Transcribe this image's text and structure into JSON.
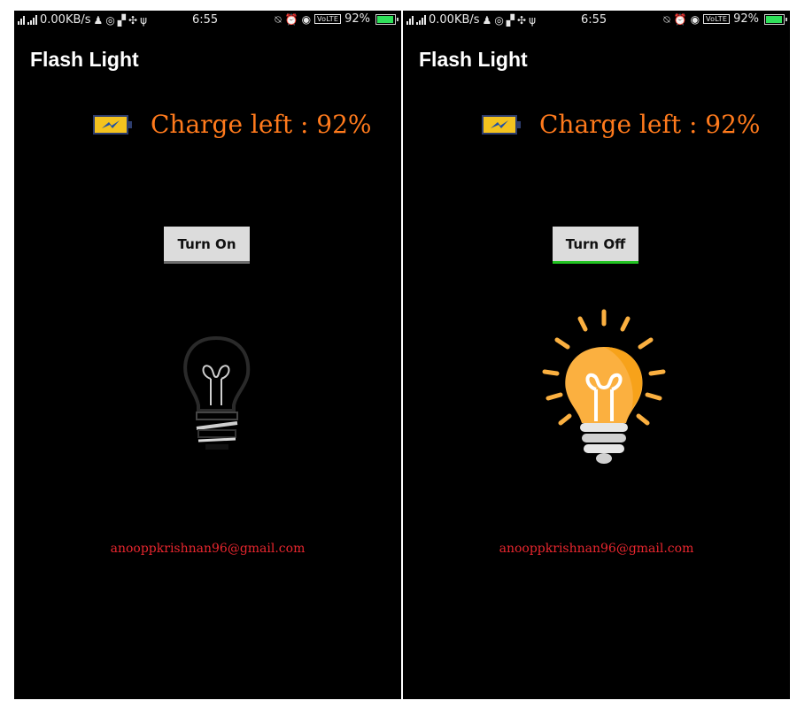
{
  "status_bar": {
    "network_type": "4G",
    "data_rate": "0.00KB/s",
    "time": "6:55",
    "volte": "VoLTE",
    "battery_percent": "92%"
  },
  "screens": [
    {
      "app_title": "Flash Light",
      "charge_text": "Charge left : 92%",
      "button_label": "Turn On",
      "flash_state": "off",
      "email": "anooppkrishnan96@gmail.com"
    },
    {
      "app_title": "Flash Light",
      "charge_text": "Charge left : 92%",
      "button_label": "Turn Off",
      "flash_state": "on",
      "email": "anooppkrishnan96@gmail.com"
    }
  ],
  "colors": {
    "charge_text": "#ff7a1c",
    "email_text": "#e8262e",
    "bulb_on": "#fbb040",
    "button_on_indicator": "#22c322"
  },
  "icons": [
    "signal-icon",
    "notification-icon",
    "whatsapp-icon",
    "flipboard-icon",
    "usb-icon",
    "mute-icon",
    "alarm-icon",
    "eye-icon",
    "battery-icon",
    "bulb-off-icon",
    "bulb-on-icon",
    "battery-charge-icon"
  ]
}
